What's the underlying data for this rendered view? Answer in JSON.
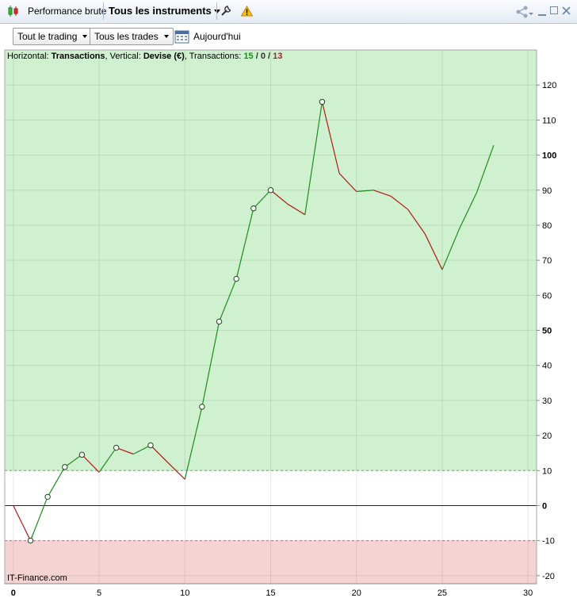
{
  "titlebar": {
    "tab1": "Performance brute",
    "tab2": "Tous les instruments"
  },
  "toolbar": {
    "filter_trading": "Tout le trading",
    "filter_trades": "Tous les trades",
    "today": "Aujourd'hui"
  },
  "info": {
    "h_label": "Horizontal:",
    "h_value": "Transactions",
    "v_label": "Vertical:",
    "v_value": "Devise (€)",
    "t_label": "Transactions:",
    "wins": "15",
    "sep1": "/",
    "neutral": "0",
    "sep2": "/",
    "losses": "13"
  },
  "watermark": "IT-Finance.com",
  "colors": {
    "positive_zone": "#cff1cf",
    "negative_zone": "#f6d3d3",
    "up_line": "#1f8c1f",
    "down_line": "#b01818",
    "zero_line": "#1c1c5a"
  },
  "chart_data": {
    "type": "line",
    "title": "",
    "xlabel": "",
    "ylabel": "",
    "xlim": [
      0,
      30
    ],
    "ylim": [
      -20,
      120
    ],
    "x_ticks": [
      0,
      5,
      10,
      15,
      20,
      25,
      30
    ],
    "y_ticks": [
      120,
      110,
      100,
      90,
      80,
      70,
      60,
      50,
      40,
      30,
      20,
      10,
      0,
      -10,
      -20
    ],
    "bold_y_ticks": [
      100,
      50,
      0
    ],
    "bold_x_ticks": [
      0
    ],
    "green_zone_from": 10,
    "red_zone_to": -10,
    "x": [
      0,
      1,
      2,
      3,
      4,
      5,
      6,
      7,
      8,
      9,
      10,
      11,
      12,
      13,
      14,
      15,
      16,
      17,
      18,
      19,
      20,
      21,
      22,
      23,
      24,
      25,
      26,
      27,
      28
    ],
    "y": [
      0,
      -10,
      2.5,
      11,
      14.5,
      9.5,
      16.5,
      14.7,
      17.2,
      12.3,
      7.5,
      28.2,
      52.5,
      64.7,
      84.8,
      90,
      86,
      83,
      115.2,
      94.8,
      89.6,
      90,
      88.3,
      84.5,
      77.5,
      67.3,
      79,
      89.2,
      102.8
    ],
    "markers": [
      1,
      2,
      3,
      4,
      6,
      8,
      11,
      12,
      13,
      14,
      15,
      18
    ],
    "grid": true
  }
}
